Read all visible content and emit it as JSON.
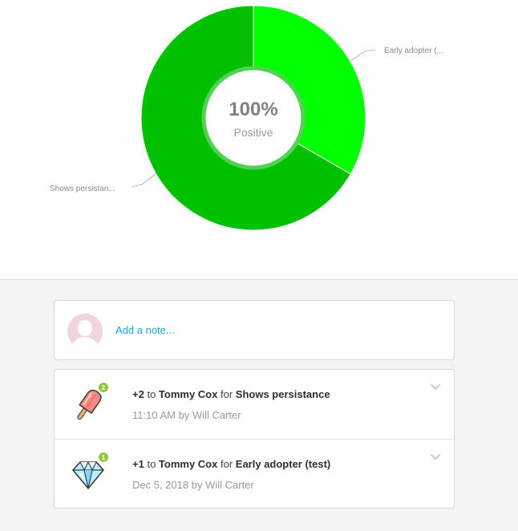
{
  "chart_data": {
    "type": "pie",
    "categories": [
      "Early adopter (...",
      "Shows persistan..."
    ],
    "values": [
      1,
      2
    ],
    "colors": [
      "#00ff00",
      "#00c000"
    ],
    "center_value": "100%",
    "center_label": "Positive"
  },
  "note": {
    "placeholder": "Add a note..."
  },
  "feed": {
    "items": [
      {
        "icon": "popsicle-icon",
        "badge": "2",
        "points": "+2",
        "to_word": "to",
        "student": "Tommy Cox",
        "for_word": "for",
        "behavior": "Shows persistance",
        "meta": "11:10 AM by Will Carter"
      },
      {
        "icon": "diamond-icon",
        "badge": "1",
        "points": "+1",
        "to_word": "to",
        "student": "Tommy Cox",
        "for_word": "for",
        "behavior": "Early adopter (test)",
        "meta": "Dec 5, 2018 by Will Carter"
      }
    ]
  }
}
